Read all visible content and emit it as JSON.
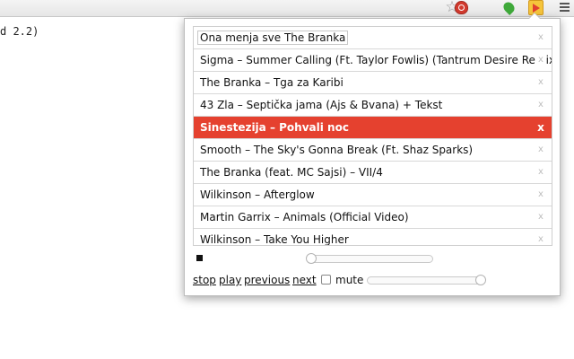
{
  "toolbar": {
    "icons": [
      "star-icon",
      "red-extension-icon",
      "green-extension-icon",
      "player-extension-icon",
      "menu-icon"
    ]
  },
  "background": {
    "code_text": "d 2.2)"
  },
  "playlist": {
    "tracks": [
      {
        "title": "Ona menja sve The Branka",
        "active": false
      },
      {
        "title": "Sigma – Summer Calling (Ft. Taylor Fowlis) (Tantrum Desire Remix)",
        "active": false
      },
      {
        "title": "The Branka – Tga za Karibi",
        "active": false
      },
      {
        "title": "43 Zla – Septička jama (Ajs & Bvana) + Tekst",
        "active": false
      },
      {
        "title": "Sinestezija – Pohvali noc",
        "active": true
      },
      {
        "title": "Smooth – The Sky's Gonna Break (Ft. Shaz Sparks)",
        "active": false
      },
      {
        "title": "The Branka (feat. MC Sajsi) – VII/4",
        "active": false
      },
      {
        "title": "Wilkinson – Afterglow",
        "active": false
      },
      {
        "title": "Martin Garrix – Animals (Official Video)",
        "active": false
      },
      {
        "title": "Wilkinson – Take You Higher",
        "active": false
      }
    ],
    "remove_glyph": "x",
    "active_color": "#e5412f"
  },
  "controls": {
    "stop": "stop",
    "play": "play",
    "previous": "previous",
    "next": "next",
    "mute_label": "mute",
    "mute_checked": false,
    "seek_fraction": 0.0,
    "volume_fraction": 1.0
  }
}
